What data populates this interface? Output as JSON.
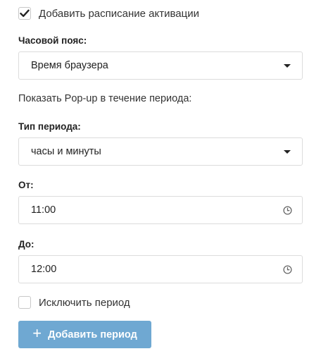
{
  "schedule": {
    "enable_label": "Добавить расписание активации",
    "enable_checked": true
  },
  "timezone": {
    "label": "Часовой пояс:",
    "value": "Время браузера"
  },
  "period_heading": "Показать Pop-up в течение периода:",
  "period_type": {
    "label": "Тип периода:",
    "value": "часы и минуты"
  },
  "from": {
    "label": "От:",
    "value": "11:00"
  },
  "to": {
    "label": "До:",
    "value": "12:00"
  },
  "exclude": {
    "label": "Исключить период",
    "checked": false
  },
  "add_button": {
    "icon": "+",
    "label": "Добавить период"
  },
  "colors": {
    "accent_button": "#6fa8d2",
    "border": "#dcdcdc"
  }
}
